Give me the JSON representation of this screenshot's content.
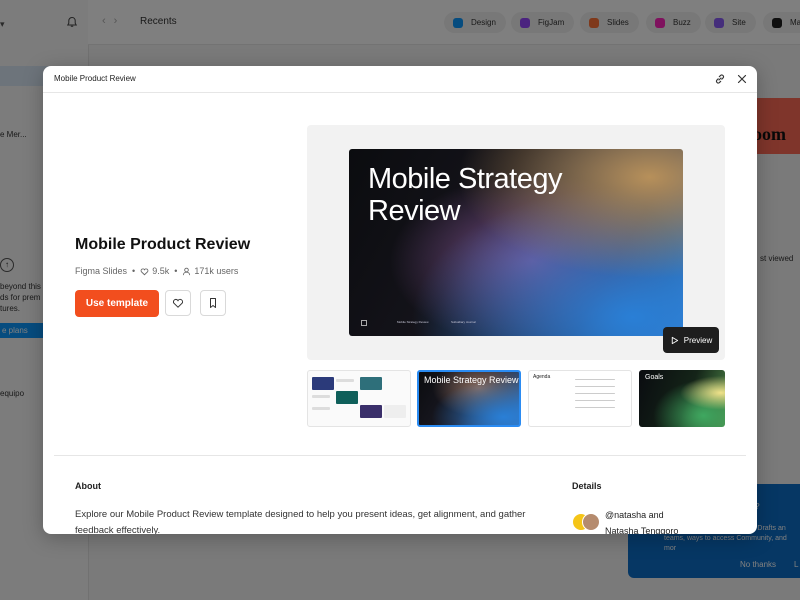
{
  "background": {
    "topbar": {
      "breadcrumb": "Recents",
      "products": [
        {
          "label": "Design",
          "color": "#0d99ff"
        },
        {
          "label": "FigJam",
          "color": "#9747ff"
        },
        {
          "label": "Slides",
          "color": "#ff7237"
        },
        {
          "label": "Buzz",
          "color": "#ff24bd"
        },
        {
          "label": "Site",
          "color": "#8b5cf6"
        },
        {
          "label": "Ma",
          "color": "#1e1e1e"
        }
      ]
    },
    "sidebar": {
      "file_label": "e Mer...",
      "upgrade_lines": [
        "beyond this",
        "ds for prem",
        "tures."
      ],
      "plans_button": "e plans",
      "team_label": "equipo"
    },
    "right_panel": {
      "banner_text": "loom",
      "recent_label": "st viewed"
    },
    "popup": {
      "title": "er?",
      "line1": "st Drafts an",
      "line2": "teams, ways to access Community, and mor",
      "no_thanks": "No thanks",
      "other": "L"
    }
  },
  "modal": {
    "header_title": "Mobile Product Review",
    "title": "Mobile Product Review",
    "meta": {
      "product": "Figma Slides",
      "likes": "9.5k",
      "users": "171k users"
    },
    "use_template_label": "Use template",
    "preview": {
      "slide_title": "Mobile Strategy Review",
      "footer_center": "Mobile Strategy Review",
      "footer_right": "Subsidiary Journal",
      "preview_label": "Preview"
    },
    "thumbnails": [
      {
        "label": ""
      },
      {
        "label": "Mobile Strategy Review"
      },
      {
        "label": "Agenda"
      },
      {
        "label": "Goals"
      }
    ],
    "about": {
      "heading": "About",
      "text": "Explore our Mobile Product Review template designed to help you present ideas, get alignment, and gather feedback effectively."
    },
    "details": {
      "heading": "Details",
      "creator_line1": "@natasha and",
      "creator_line2": "Natasha Tenggoro"
    }
  }
}
